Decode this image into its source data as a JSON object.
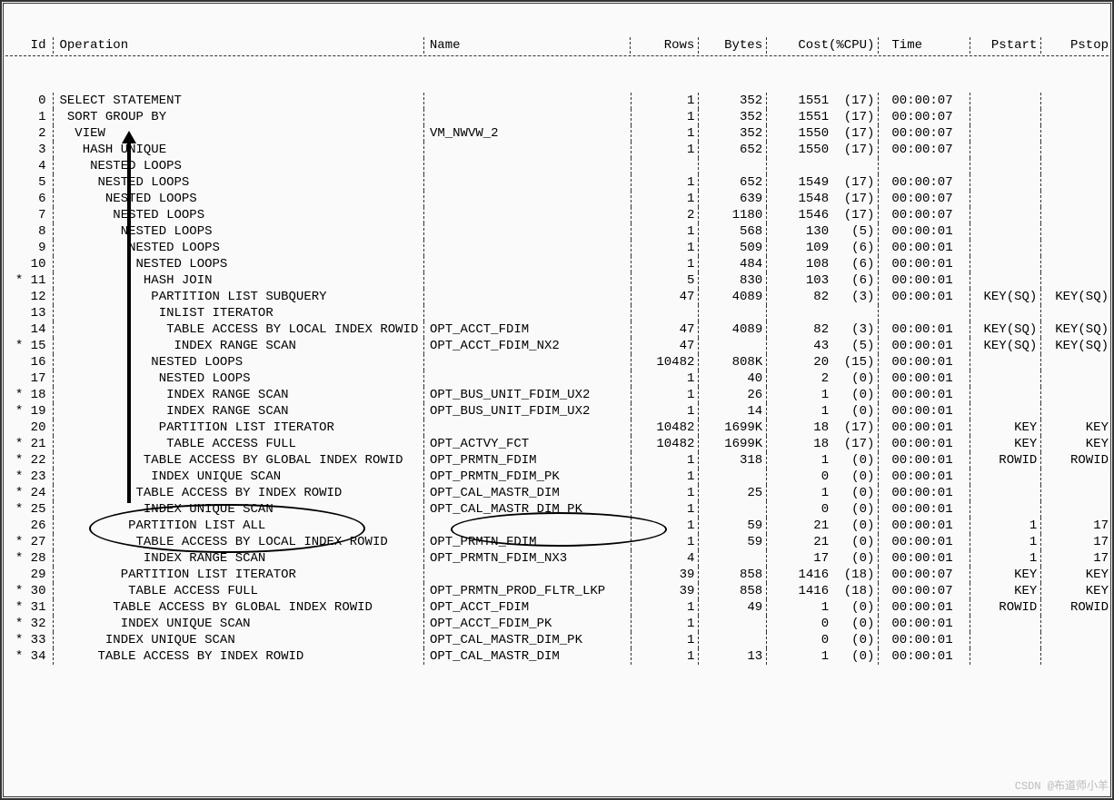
{
  "headers": {
    "id": "Id",
    "op": "Operation",
    "name": "Name",
    "rows": "Rows",
    "bytes": "Bytes",
    "cost": "Cost",
    "cpu": "(%CPU)",
    "time": "Time",
    "pstart": "Pstart",
    "pstop": "Pstop"
  },
  "rows": [
    {
      "star": "",
      "id": "0",
      "indent": 0,
      "op": "SELECT STATEMENT",
      "name": "",
      "rows": "1",
      "bytes": "352",
      "cost": "1551",
      "cpu": "(17)",
      "time": "00:00:07",
      "ps": "",
      "pe": ""
    },
    {
      "star": "",
      "id": "1",
      "indent": 1,
      "op": "SORT GROUP BY",
      "name": "",
      "rows": "1",
      "bytes": "352",
      "cost": "1551",
      "cpu": "(17)",
      "time": "00:00:07",
      "ps": "",
      "pe": ""
    },
    {
      "star": "",
      "id": "2",
      "indent": 2,
      "op": "VIEW",
      "name": "VM_NWVW_2",
      "rows": "1",
      "bytes": "352",
      "cost": "1550",
      "cpu": "(17)",
      "time": "00:00:07",
      "ps": "",
      "pe": ""
    },
    {
      "star": "",
      "id": "3",
      "indent": 3,
      "op": "HASH UNIQUE",
      "name": "",
      "rows": "1",
      "bytes": "652",
      "cost": "1550",
      "cpu": "(17)",
      "time": "00:00:07",
      "ps": "",
      "pe": ""
    },
    {
      "star": "",
      "id": "4",
      "indent": 4,
      "op": "NESTED LOOPS",
      "name": "",
      "rows": "",
      "bytes": "",
      "cost": "",
      "cpu": "",
      "time": "",
      "ps": "",
      "pe": ""
    },
    {
      "star": "",
      "id": "5",
      "indent": 5,
      "op": "NESTED LOOPS",
      "name": "",
      "rows": "1",
      "bytes": "652",
      "cost": "1549",
      "cpu": "(17)",
      "time": "00:00:07",
      "ps": "",
      "pe": ""
    },
    {
      "star": "",
      "id": "6",
      "indent": 6,
      "op": "NESTED LOOPS",
      "name": "",
      "rows": "1",
      "bytes": "639",
      "cost": "1548",
      "cpu": "(17)",
      "time": "00:00:07",
      "ps": "",
      "pe": ""
    },
    {
      "star": "",
      "id": "7",
      "indent": 7,
      "op": "NESTED LOOPS",
      "name": "",
      "rows": "2",
      "bytes": "1180",
      "cost": "1546",
      "cpu": "(17)",
      "time": "00:00:07",
      "ps": "",
      "pe": ""
    },
    {
      "star": "",
      "id": "8",
      "indent": 8,
      "op": "NESTED LOOPS",
      "name": "",
      "rows": "1",
      "bytes": "568",
      "cost": "130",
      "cpu": "(5)",
      "time": "00:00:01",
      "ps": "",
      "pe": ""
    },
    {
      "star": "",
      "id": "9",
      "indent": 9,
      "op": "NESTED LOOPS",
      "name": "",
      "rows": "1",
      "bytes": "509",
      "cost": "109",
      "cpu": "(6)",
      "time": "00:00:01",
      "ps": "",
      "pe": ""
    },
    {
      "star": "",
      "id": "10",
      "indent": 10,
      "op": "NESTED LOOPS",
      "name": "",
      "rows": "1",
      "bytes": "484",
      "cost": "108",
      "cpu": "(6)",
      "time": "00:00:01",
      "ps": "",
      "pe": ""
    },
    {
      "star": "*",
      "id": "11",
      "indent": 11,
      "op": "HASH JOIN",
      "name": "",
      "rows": "5",
      "bytes": "830",
      "cost": "103",
      "cpu": "(6)",
      "time": "00:00:01",
      "ps": "",
      "pe": ""
    },
    {
      "star": "",
      "id": "12",
      "indent": 12,
      "op": "PARTITION LIST SUBQUERY",
      "name": "",
      "rows": "47",
      "bytes": "4089",
      "cost": "82",
      "cpu": "(3)",
      "time": "00:00:01",
      "ps": "KEY(SQ)",
      "pe": "KEY(SQ)"
    },
    {
      "star": "",
      "id": "13",
      "indent": 13,
      "op": "INLIST ITERATOR",
      "name": "",
      "rows": "",
      "bytes": "",
      "cost": "",
      "cpu": "",
      "time": "",
      "ps": "",
      "pe": ""
    },
    {
      "star": "",
      "id": "14",
      "indent": 14,
      "op": "TABLE ACCESS BY LOCAL INDEX ROWID",
      "name": "OPT_ACCT_FDIM",
      "rows": "47",
      "bytes": "4089",
      "cost": "82",
      "cpu": "(3)",
      "time": "00:00:01",
      "ps": "KEY(SQ)",
      "pe": "KEY(SQ)"
    },
    {
      "star": "*",
      "id": "15",
      "indent": 15,
      "op": "INDEX RANGE SCAN",
      "name": "OPT_ACCT_FDIM_NX2",
      "rows": "47",
      "bytes": "",
      "cost": "43",
      "cpu": "(5)",
      "time": "00:00:01",
      "ps": "KEY(SQ)",
      "pe": "KEY(SQ)"
    },
    {
      "star": "",
      "id": "16",
      "indent": 12,
      "op": "NESTED LOOPS",
      "name": "",
      "rows": "10482",
      "bytes": "808K",
      "cost": "20",
      "cpu": "(15)",
      "time": "00:00:01",
      "ps": "",
      "pe": ""
    },
    {
      "star": "",
      "id": "17",
      "indent": 13,
      "op": "NESTED LOOPS",
      "name": "",
      "rows": "1",
      "bytes": "40",
      "cost": "2",
      "cpu": "(0)",
      "time": "00:00:01",
      "ps": "",
      "pe": ""
    },
    {
      "star": "*",
      "id": "18",
      "indent": 14,
      "op": "INDEX RANGE SCAN",
      "name": "OPT_BUS_UNIT_FDIM_UX2",
      "rows": "1",
      "bytes": "26",
      "cost": "1",
      "cpu": "(0)",
      "time": "00:00:01",
      "ps": "",
      "pe": ""
    },
    {
      "star": "*",
      "id": "19",
      "indent": 14,
      "op": "INDEX RANGE SCAN",
      "name": "OPT_BUS_UNIT_FDIM_UX2",
      "rows": "1",
      "bytes": "14",
      "cost": "1",
      "cpu": "(0)",
      "time": "00:00:01",
      "ps": "",
      "pe": ""
    },
    {
      "star": "",
      "id": "20",
      "indent": 13,
      "op": "PARTITION LIST ITERATOR",
      "name": "",
      "rows": "10482",
      "bytes": "1699K",
      "cost": "18",
      "cpu": "(17)",
      "time": "00:00:01",
      "ps": "KEY",
      "pe": "KEY"
    },
    {
      "star": "*",
      "id": "21",
      "indent": 14,
      "op": "TABLE ACCESS FULL",
      "name": "OPT_ACTVY_FCT",
      "rows": "10482",
      "bytes": "1699K",
      "cost": "18",
      "cpu": "(17)",
      "time": "00:00:01",
      "ps": "KEY",
      "pe": "KEY"
    },
    {
      "star": "*",
      "id": "22",
      "indent": 11,
      "op": "TABLE ACCESS BY GLOBAL INDEX ROWID",
      "name": "OPT_PRMTN_FDIM",
      "rows": "1",
      "bytes": "318",
      "cost": "1",
      "cpu": "(0)",
      "time": "00:00:01",
      "ps": "ROWID",
      "pe": "ROWID"
    },
    {
      "star": "*",
      "id": "23",
      "indent": 12,
      "op": "INDEX UNIQUE SCAN",
      "name": "OPT_PRMTN_FDIM_PK",
      "rows": "1",
      "bytes": "",
      "cost": "0",
      "cpu": "(0)",
      "time": "00:00:01",
      "ps": "",
      "pe": ""
    },
    {
      "star": "*",
      "id": "24",
      "indent": 10,
      "op": "TABLE ACCESS BY INDEX ROWID",
      "name": "OPT_CAL_MASTR_DIM",
      "rows": "1",
      "bytes": "25",
      "cost": "1",
      "cpu": "(0)",
      "time": "00:00:01",
      "ps": "",
      "pe": ""
    },
    {
      "star": "*",
      "id": "25",
      "indent": 11,
      "op": "INDEX UNIQUE SCAN",
      "name": "OPT_CAL_MASTR_DIM_PK",
      "rows": "1",
      "bytes": "",
      "cost": "0",
      "cpu": "(0)",
      "time": "00:00:01",
      "ps": "",
      "pe": ""
    },
    {
      "star": "",
      "id": "26",
      "indent": 9,
      "op": "PARTITION LIST ALL",
      "name": "",
      "rows": "1",
      "bytes": "59",
      "cost": "21",
      "cpu": "(0)",
      "time": "00:00:01",
      "ps": "1",
      "pe": "17"
    },
    {
      "star": "*",
      "id": "27",
      "indent": 10,
      "op": "TABLE ACCESS BY LOCAL INDEX ROWID",
      "name": "OPT_PRMTN_FDIM",
      "rows": "1",
      "bytes": "59",
      "cost": "21",
      "cpu": "(0)",
      "time": "00:00:01",
      "ps": "1",
      "pe": "17"
    },
    {
      "star": "*",
      "id": "28",
      "indent": 11,
      "op": "INDEX RANGE SCAN",
      "name": "OPT_PRMTN_FDIM_NX3",
      "rows": "4",
      "bytes": "",
      "cost": "17",
      "cpu": "(0)",
      "time": "00:00:01",
      "ps": "1",
      "pe": "17"
    },
    {
      "star": "",
      "id": "29",
      "indent": 8,
      "op": "PARTITION LIST ITERATOR",
      "name": "",
      "rows": "39",
      "bytes": "858",
      "cost": "1416",
      "cpu": "(18)",
      "time": "00:00:07",
      "ps": "KEY",
      "pe": "KEY"
    },
    {
      "star": "*",
      "id": "30",
      "indent": 9,
      "op": "TABLE ACCESS FULL",
      "name": "OPT_PRMTN_PROD_FLTR_LKP",
      "rows": "39",
      "bytes": "858",
      "cost": "1416",
      "cpu": "(18)",
      "time": "00:00:07",
      "ps": "KEY",
      "pe": "KEY"
    },
    {
      "star": "*",
      "id": "31",
      "indent": 7,
      "op": "TABLE ACCESS BY GLOBAL INDEX ROWID",
      "name": "OPT_ACCT_FDIM",
      "rows": "1",
      "bytes": "49",
      "cost": "1",
      "cpu": "(0)",
      "time": "00:00:01",
      "ps": "ROWID",
      "pe": "ROWID"
    },
    {
      "star": "*",
      "id": "32",
      "indent": 8,
      "op": "INDEX UNIQUE SCAN",
      "name": "OPT_ACCT_FDIM_PK",
      "rows": "1",
      "bytes": "",
      "cost": "0",
      "cpu": "(0)",
      "time": "00:00:01",
      "ps": "",
      "pe": ""
    },
    {
      "star": "*",
      "id": "33",
      "indent": 6,
      "op": "INDEX UNIQUE SCAN",
      "name": "OPT_CAL_MASTR_DIM_PK",
      "rows": "1",
      "bytes": "",
      "cost": "0",
      "cpu": "(0)",
      "time": "00:00:01",
      "ps": "",
      "pe": ""
    },
    {
      "star": "*",
      "id": "34",
      "indent": 5,
      "op": "TABLE ACCESS BY INDEX ROWID",
      "name": "OPT_CAL_MASTR_DIM",
      "rows": "1",
      "bytes": "13",
      "cost": "1",
      "cpu": "(0)",
      "time": "00:00:01",
      "ps": "",
      "pe": ""
    }
  ],
  "watermark": "CSDN @布道师小羊"
}
